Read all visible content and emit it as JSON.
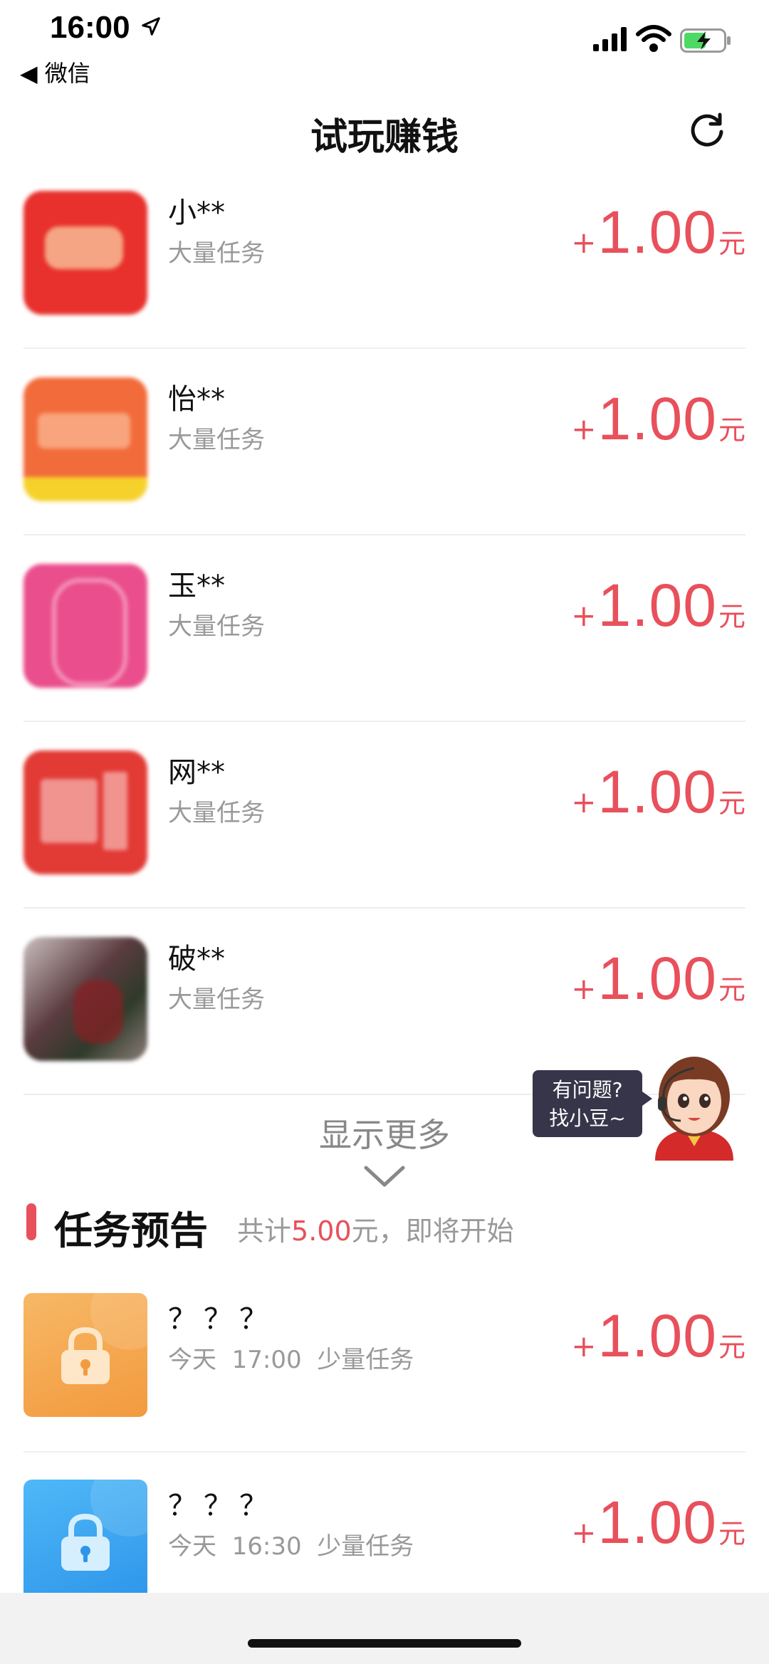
{
  "status_bar": {
    "time": "16:00",
    "back_label": "◀ 微信"
  },
  "nav": {
    "title": "试玩赚钱"
  },
  "tasks": [
    {
      "name": "小**",
      "desc": "大量任务",
      "plus": "+",
      "amount": "1.00",
      "unit": "元",
      "icon_color": "#e8302c"
    },
    {
      "name": "怡**",
      "desc": "大量任务",
      "plus": "+",
      "amount": "1.00",
      "unit": "元",
      "icon_color": "#f26b3a"
    },
    {
      "name": "玉**",
      "desc": "大量任务",
      "plus": "+",
      "amount": "1.00",
      "unit": "元",
      "icon_color": "#ea4e8c"
    },
    {
      "name": "网**",
      "desc": "大量任务",
      "plus": "+",
      "amount": "1.00",
      "unit": "元",
      "icon_color": "#e23a35"
    },
    {
      "name": "破**",
      "desc": "大量任务",
      "plus": "+",
      "amount": "1.00",
      "unit": "元",
      "icon_color": "#6b5a5a"
    }
  ],
  "show_more": "显示更多",
  "helper": {
    "line1": "有问题?",
    "line2": "找小豆~"
  },
  "preview": {
    "title": "任务预告",
    "sub_prefix": "共计",
    "sub_amount": "5.00",
    "sub_suffix": "元，即将开始",
    "items": [
      {
        "name": "？？？",
        "desc": "今天  17:00  少量任务",
        "plus": "+",
        "amount": "1.00",
        "unit": "元",
        "tile_color": "#f5a24a",
        "icon": "lock-icon"
      },
      {
        "name": "？？？",
        "desc": "今天  16:30  少量任务",
        "plus": "+",
        "amount": "1.00",
        "unit": "元",
        "tile_color": "#3fa9f5",
        "icon": "lock-icon"
      }
    ]
  },
  "colors": {
    "accent": "#e8505b",
    "muted": "#999999"
  }
}
